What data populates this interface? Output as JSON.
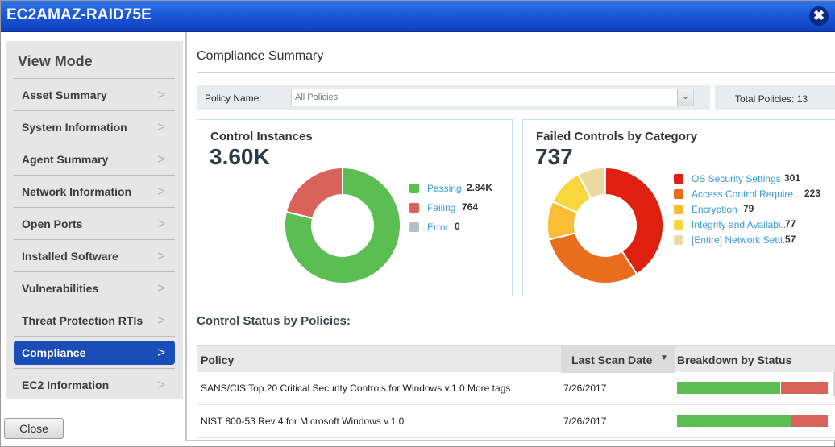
{
  "window": {
    "title": "EC2AMAZ-RAID75E",
    "close_icon": "close-circle-icon"
  },
  "sidebar": {
    "title": "View Mode",
    "items": [
      {
        "label": "Asset Summary",
        "active": false
      },
      {
        "label": "System Information",
        "active": false
      },
      {
        "label": "Agent Summary",
        "active": false
      },
      {
        "label": "Network Information",
        "active": false
      },
      {
        "label": "Open Ports",
        "active": false
      },
      {
        "label": "Installed Software",
        "active": false
      },
      {
        "label": "Vulnerabilities",
        "active": false
      },
      {
        "label": "Threat Protection RTIs",
        "active": false
      },
      {
        "label": "Compliance",
        "active": true
      },
      {
        "label": "EC2 Information",
        "active": false
      }
    ],
    "close_button": "Close"
  },
  "main": {
    "title": "Compliance Summary",
    "filter": {
      "label": "Policy Name:",
      "selected": "All Policies"
    },
    "total_policies": "Total Policies: 13",
    "section_title": "Control Status by Policies:",
    "table": {
      "headers": [
        "Policy",
        "Last Scan Date",
        "Breakdown by Status"
      ],
      "rows": [
        {
          "policy": "SANS/CIS Top 20 Critical Security Controls for Windows v.1.0 More tags",
          "date": "7/26/2017",
          "passing_pct": 69,
          "failing_pct": 31
        },
        {
          "policy": "NIST 800-53 Rev 4 for Microsoft Windows v.1.0",
          "date": "7/26/2017",
          "passing_pct": 76,
          "failing_pct": 24
        }
      ]
    }
  },
  "chart_data": [
    {
      "type": "pie",
      "title": "Control Instances",
      "total": "3.60K",
      "categories": [
        "Passing",
        "Failing",
        "Error"
      ],
      "values": [
        2840,
        764,
        0
      ],
      "value_labels": [
        "2.84K",
        "764",
        "0"
      ],
      "colors": [
        "#5cbd52",
        "#d9625a",
        "#b3bec6"
      ],
      "legend": "right"
    },
    {
      "type": "pie",
      "title": "Failed Controls by Category",
      "total": "737",
      "categories": [
        "OS Security Settings",
        "Access Control Require...",
        "Encryption",
        "Integrity and Availabi...",
        "[Entire] Network Setti..."
      ],
      "values": [
        301,
        223,
        79,
        77,
        57
      ],
      "value_labels": [
        "301",
        "223",
        "79",
        "77",
        "57"
      ],
      "colors": [
        "#e0200f",
        "#e86d1c",
        "#fbbd36",
        "#f8d73c",
        "#ecd9a0"
      ],
      "legend": "right"
    }
  ]
}
